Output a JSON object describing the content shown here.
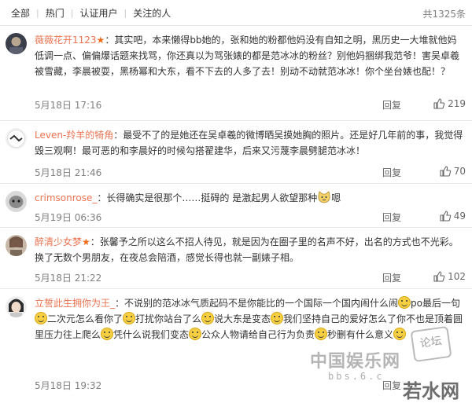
{
  "tabs": {
    "items": [
      "全部",
      "热门",
      "认证用户",
      "关注的人"
    ],
    "total": "共1325条"
  },
  "comments": [
    {
      "user": "薇薇花开1123",
      "badge": "★",
      "text_a": "：其实吧，本来懒得bb她的，张和她的粉都他妈没有自知之明，黑历史一大堆就他妈低调一点、偏偏爆话题来找骂，你还真以为骂张婊的都是范冰冰的粉丝？别他妈捆绑我范爷！害吴卓羲被雪藏，李晨被耍，黑杨幂和大东，看不下去的人多了去！别动不动就范冰冰！你个坐台婊也配！？",
      "time": "5月18日 17:16",
      "reply": "回复",
      "likes": "219"
    },
    {
      "user": "Leven-羚羊的犄角",
      "text_a": "：最受不了的是她还在吴卓羲的微博晒吴摸她胸的照片。还是好几年前的事，我觉得毁三观啊！最可恶的和李晨好的时候勾搭翟建华，后来又污蔑李晨劈腿范冰冰！",
      "time": "5月18日 21:46",
      "reply": "回复",
      "likes": "70"
    },
    {
      "user": "crimsonrose_",
      "text_a": "：长得确实是很那个……挺碍的 是激起男人欲望那种",
      "text_b": "嗯",
      "time": "5月19日 06:36",
      "reply": "回复",
      "likes": "49"
    },
    {
      "user": "醉清少女梦",
      "badge": "★",
      "text_a": "：张馨予之所以这么不招人待见，就是因为在圈子里的名声不好，出名的方式也不光彩。换了无数个男朋友，在夜总会陪酒，感觉长得也就一副婊子相。",
      "time": "5月18日 21:22",
      "reply": "回复",
      "likes": "102"
    },
    {
      "user": "立誓此生拥你为王_",
      "seg1": "：不说别的范冰冰气质起码不是你能比的一个国际一个国内闹什么闹",
      "seg2": "po最后一句",
      "seg3": "二次元怎么看你了",
      "seg4": "打扰你站台了么",
      "seg5": "说大东是变态",
      "seg6": "我们坚持自己的爱好怎么了你不也是顶着圆里压力往上爬么",
      "seg7": "凭什么说我们变态",
      "seg8": "公众人物请给自己行为负责",
      "seg9": "秒删有什么意义",
      "time": "5月18日 19:32",
      "reply": "回复"
    }
  ],
  "watermarks": {
    "site": "中国娱乐网",
    "url": "bbs.6.c",
    "seal": "论坛",
    "brand": "若水网"
  },
  "colors": {
    "username": "#eb7350",
    "badge": "#f06b1a",
    "text": "#333333",
    "meta": "#808080"
  }
}
